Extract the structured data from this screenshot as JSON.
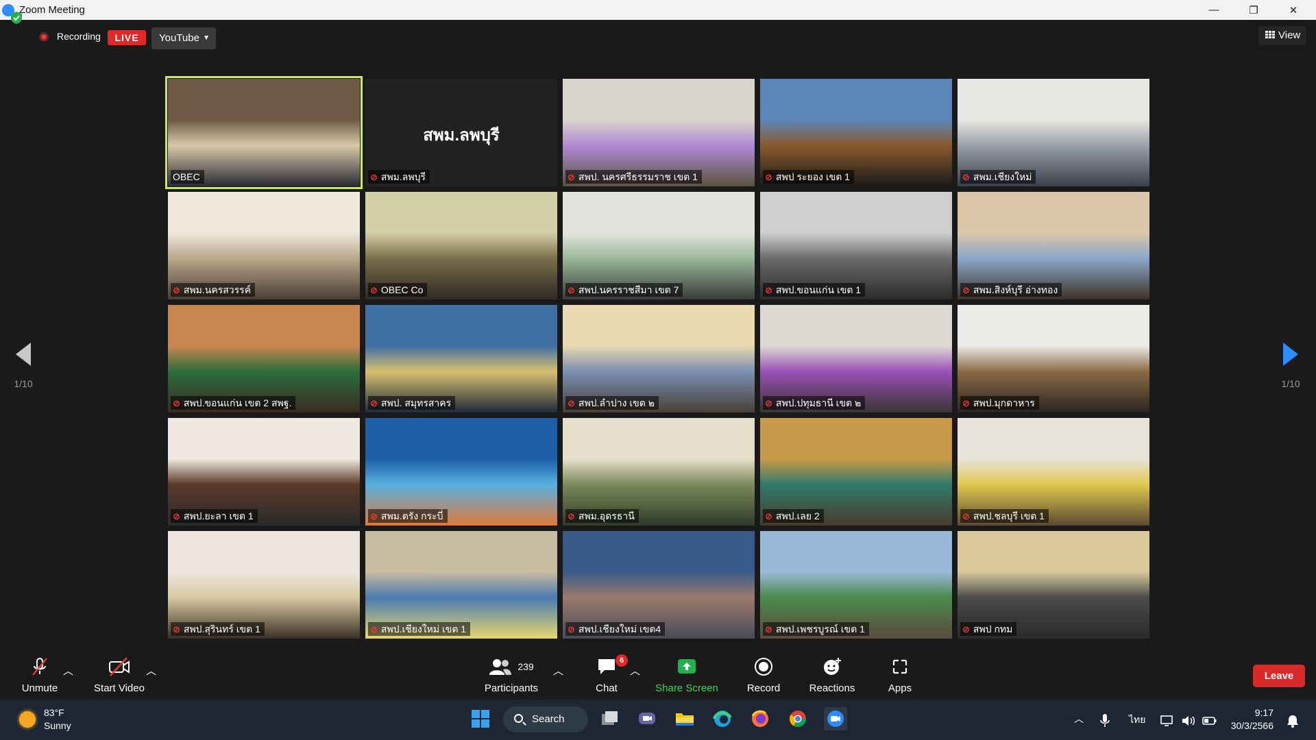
{
  "window": {
    "title": "Zoom Meeting",
    "minimize": "—",
    "restore": "❐",
    "close": "✕"
  },
  "topbar": {
    "recording_label": "Recording",
    "live_badge": "LIVE",
    "stream_target": "YouTube",
    "view_label": "View"
  },
  "pager": {
    "left_page": "1/10",
    "right_page": "1/10"
  },
  "gallery": {
    "tiles": [
      {
        "name": "OBEC",
        "muted": false,
        "active": true,
        "blank": false,
        "colors": [
          "#6e5a45",
          "#d8c9a8",
          "#2a2a35"
        ]
      },
      {
        "name": "สพม.ลพบุรี",
        "muted": true,
        "active": false,
        "blank": true,
        "big_name": "สพม.ลพบุรี",
        "colors": [
          "#222222",
          "#222222",
          "#222222"
        ]
      },
      {
        "name": "สพป. นครศรีธรรมราช เขต 1",
        "muted": true,
        "active": false,
        "blank": false,
        "colors": [
          "#d9d4c9",
          "#b08ad4",
          "#5a5240"
        ]
      },
      {
        "name": "สพป ระยอง เขต 1",
        "muted": true,
        "active": false,
        "blank": false,
        "colors": [
          "#5d86b8",
          "#8a5a2c",
          "#1a1a1a"
        ]
      },
      {
        "name": "สพม.เชียงใหม่",
        "muted": true,
        "active": false,
        "blank": false,
        "colors": [
          "#e8e6e2",
          "#9aa0a8",
          "#3a3f4a"
        ]
      },
      {
        "name": "สพม.นครสวรรค์",
        "muted": true,
        "active": false,
        "blank": false,
        "colors": [
          "#efe9dc",
          "#b9a78a",
          "#4a3e35"
        ]
      },
      {
        "name": "OBEC Co",
        "muted": true,
        "active": false,
        "blank": false,
        "colors": [
          "#d5cfa8",
          "#7a6d4a",
          "#2e2a25"
        ]
      },
      {
        "name": "สพป.นครราชสีมา เขต 7",
        "muted": true,
        "active": false,
        "blank": false,
        "colors": [
          "#e3e3dd",
          "#9ab89a",
          "#3a3a3a"
        ]
      },
      {
        "name": "สพป.ขอนแก่น เขต 1",
        "muted": true,
        "active": false,
        "blank": false,
        "colors": [
          "#cfcfcf",
          "#6a6a6a",
          "#2b2b2b"
        ]
      },
      {
        "name": "สพม.สิงห์บุรี อ่างทอง",
        "muted": true,
        "active": false,
        "blank": false,
        "colors": [
          "#d9c7a8",
          "#8aa7c8",
          "#3c3328"
        ]
      },
      {
        "name": "สพป.ขอนแก่น เขต 2 สพฐ.",
        "muted": true,
        "active": false,
        "blank": false,
        "colors": [
          "#c9864e",
          "#2c6d3e",
          "#3a2a20"
        ]
      },
      {
        "name": "สพป. สมุทรสาคร",
        "muted": true,
        "active": false,
        "blank": false,
        "colors": [
          "#3f6ea3",
          "#d8c070",
          "#1e2a3a"
        ]
      },
      {
        "name": "สพป.ลำปาง เขต ๒",
        "muted": true,
        "active": false,
        "blank": false,
        "colors": [
          "#e9d9b0",
          "#7a8fb0",
          "#4a4038"
        ]
      },
      {
        "name": "สพป.ปทุมธานี เขต ๒",
        "muted": true,
        "active": false,
        "blank": false,
        "colors": [
          "#dedad3",
          "#9a4fb5",
          "#3a3535"
        ]
      },
      {
        "name": "สพป.มุกดาหาร",
        "muted": true,
        "active": false,
        "blank": false,
        "colors": [
          "#ecebe7",
          "#8a6a45",
          "#2a2520"
        ]
      },
      {
        "name": "สพป.ยะลา เขต 1",
        "muted": true,
        "active": false,
        "blank": false,
        "colors": [
          "#efe9df",
          "#5a3a2a",
          "#2a2a2a"
        ]
      },
      {
        "name": "สพม.ตรัง กระบี่",
        "muted": true,
        "active": false,
        "blank": false,
        "colors": [
          "#1c5fa8",
          "#5ab0e0",
          "#e07838"
        ]
      },
      {
        "name": "สพม.อุดรธานี",
        "muted": true,
        "active": false,
        "blank": false,
        "colors": [
          "#e6dfcb",
          "#7a8a5a",
          "#2f3a2a"
        ]
      },
      {
        "name": "สพป.เลย 2",
        "muted": true,
        "active": false,
        "blank": false,
        "colors": [
          "#c99a4a",
          "#2f7a6a",
          "#4a3a2a"
        ]
      },
      {
        "name": "สพป.ชลบุรี เขต 1",
        "muted": true,
        "active": false,
        "blank": false,
        "colors": [
          "#e8e3d8",
          "#e0c850",
          "#5a4a30"
        ]
      },
      {
        "name": "สพป.สุรินทร์ เขต 1",
        "muted": true,
        "active": false,
        "blank": false,
        "colors": [
          "#ece6de",
          "#d8c9a0",
          "#3a2f28"
        ]
      },
      {
        "name": "สพป.เชียงใหม่ เขต 1",
        "muted": true,
        "active": false,
        "blank": false,
        "colors": [
          "#c8bca0",
          "#4a7ab0",
          "#e8d870"
        ]
      },
      {
        "name": "สพป.เชียงใหม่ เขต4",
        "muted": true,
        "active": false,
        "blank": false,
        "colors": [
          "#3a5a8a",
          "#9a7a6a",
          "#4a4a5a"
        ]
      },
      {
        "name": "สพป.เพชรบูรณ์ เขต 1",
        "muted": true,
        "active": false,
        "blank": false,
        "colors": [
          "#9ab8d8",
          "#4a8a4a",
          "#5a4a40"
        ]
      },
      {
        "name": "สพป กทม",
        "muted": true,
        "active": false,
        "blank": false,
        "colors": [
          "#d8c89a",
          "#4a4a4a",
          "#2a2a2a"
        ]
      }
    ]
  },
  "toolbar": {
    "unmute": "Unmute",
    "start_video": "Start Video",
    "participants_count": "239",
    "participants": "Participants",
    "chat": "Chat",
    "chat_badge": "6",
    "share_screen": "Share Screen",
    "record": "Record",
    "reactions": "Reactions",
    "apps": "Apps",
    "leave": "Leave"
  },
  "taskbar": {
    "weather_temp": "83°F",
    "weather_desc": "Sunny",
    "search": "Search",
    "language": "ไทย",
    "time": "9:17",
    "date": "30/3/2566"
  }
}
